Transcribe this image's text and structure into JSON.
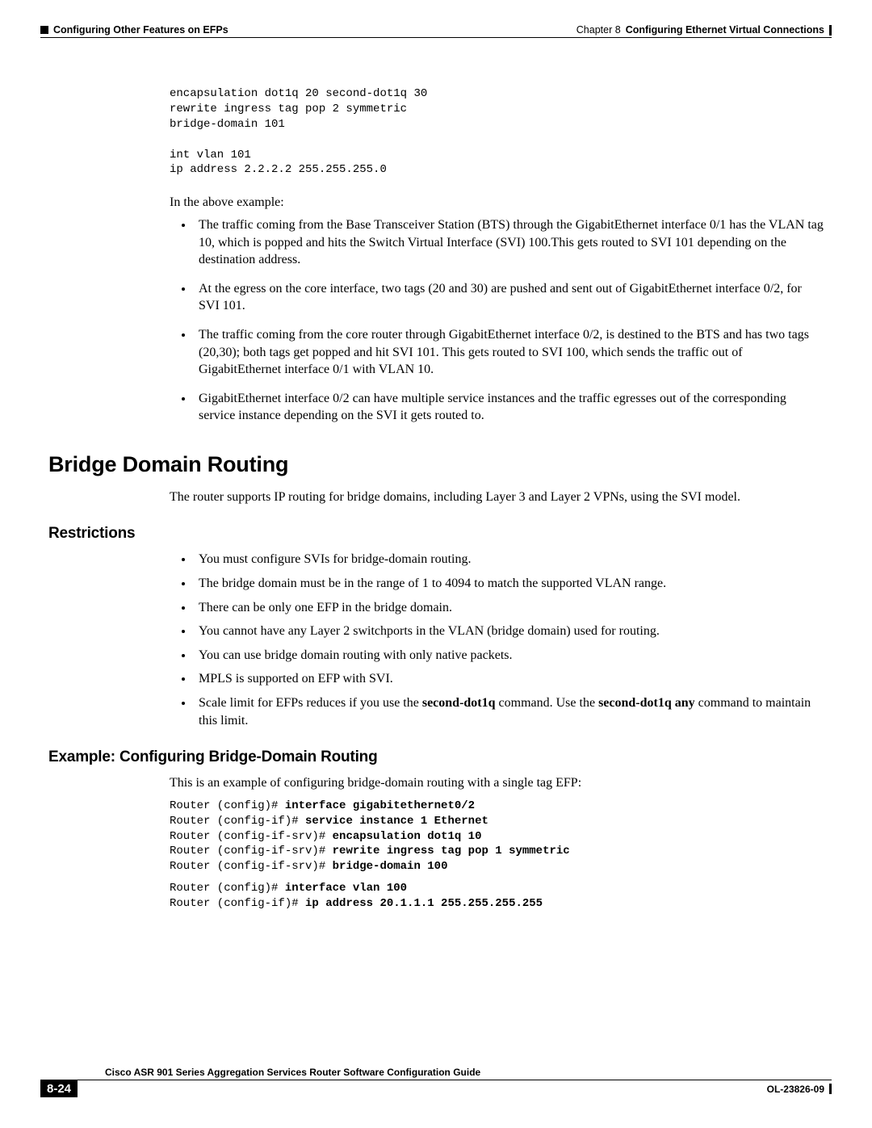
{
  "header": {
    "section": "Configuring Other Features on EFPs",
    "chapter_label": "Chapter 8",
    "chapter_title": "Configuring Ethernet Virtual Connections"
  },
  "codeblock1": "encapsulation dot1q 20 second-dot1q 30\nrewrite ingress tag pop 2 symmetric\nbridge-domain 101\n\nint vlan 101\nip address 2.2.2.2 255.255.255.0",
  "intro_para": "In the above example:",
  "bullets1": {
    "b1": "The traffic coming from the Base Transceiver Station (BTS) through the GigabitEthernet interface 0/1 has the VLAN tag 10, which is popped and hits the Switch Virtual Interface (SVI) 100.This gets routed to SVI 101 depending on the destination address.",
    "b2": "At the egress on the core interface, two tags (20 and 30) are pushed and sent out of GigabitEthernet interface 0/2, for SVI 101.",
    "b3": "The traffic coming from the core router through GigabitEthernet interface 0/2, is destined to the BTS and has two tags (20,30); both tags get popped and hit SVI 101. This gets routed to SVI 100, which sends the traffic out of GigabitEthernet interface 0/1 with VLAN 10.",
    "b4": "GigabitEthernet interface 0/2 can have multiple service instances and the traffic egresses out of the corresponding service instance depending on the SVI it gets routed to."
  },
  "section": {
    "h1": "Bridge Domain Routing",
    "para1": "The router supports IP routing for bridge domains, including Layer 3 and Layer 2 VPNs, using the SVI model.",
    "h2a": "Restrictions",
    "restrictions": {
      "r1": "You must configure SVIs for bridge-domain routing.",
      "r2": "The bridge domain must be in the range of 1 to 4094 to match the supported VLAN range.",
      "r3": "There can be only one EFP in the bridge domain.",
      "r4": "You cannot have any Layer 2 switchports in the VLAN (bridge domain) used for routing.",
      "r5": "You can use bridge domain routing with only native packets.",
      "r6": "MPLS is supported on EFP with SVI.",
      "r7_pre": "Scale limit for EFPs reduces if you use the ",
      "r7_cmd1": "second-dot1q",
      "r7_mid": " command. Use the ",
      "r7_cmd2": "second-dot1q any",
      "r7_post": " command to maintain this limit."
    },
    "h2b": "Example: Configuring Bridge-Domain Routing",
    "para2": "This is an example of configuring bridge-domain routing with a single tag EFP:",
    "code2": {
      "l1p": "Router (config)# ",
      "l1c": "interface gigabitethernet0/2",
      "l2p": "Router (config-if)# ",
      "l2c": "service instance 1 Ethernet",
      "l3p": "Router (config-if-srv)# ",
      "l3c": "encapsulation dot1q 10",
      "l4p": "Router (config-if-srv)# ",
      "l4c": "rewrite ingress tag pop 1 symmetric",
      "l5p": "Router (config-if-srv)# ",
      "l5c": "bridge-domain 100"
    },
    "code3": {
      "l1p": "Router (config)# ",
      "l1c": "interface vlan 100",
      "l2p": "Router (config-if)# ",
      "l2c": "ip address 20.1.1.1 255.255.255.255"
    }
  },
  "footer": {
    "doc_title": "Cisco ASR 901 Series Aggregation Services Router Software Configuration Guide",
    "page_num": "8-24",
    "doc_id": "OL-23826-09"
  }
}
